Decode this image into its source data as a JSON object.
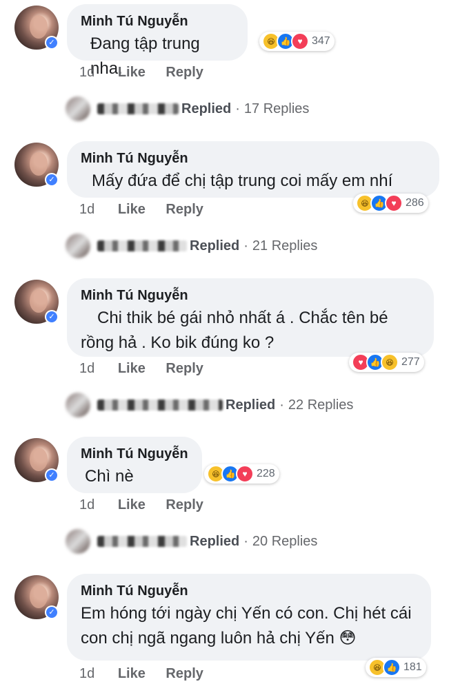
{
  "comments": [
    {
      "author": "Minh Tú Nguyễn",
      "text": "Đang tập trung nha.",
      "reactions_count": "347",
      "time": "1d",
      "like": "Like",
      "reply": "Reply",
      "replied": "Replied",
      "replies": "17 Replies"
    },
    {
      "author": "Minh Tú Nguyễn",
      "text": "Mấy đứa để chị tập trung coi mấy em nhí",
      "reactions_count": "286",
      "time": "1d",
      "like": "Like",
      "reply": "Reply",
      "replied": "Replied",
      "replies": "21 Replies"
    },
    {
      "author": "Minh Tú Nguyễn",
      "text": "Chi thik bé gái nhỏ nhất á . Chắc tên bé rồng hả . Ko bik đúng ko ?",
      "reactions_count": "277",
      "time": "1d",
      "like": "Like",
      "reply": "Reply",
      "replied": "Replied",
      "replies": "22 Replies"
    },
    {
      "author": "Minh Tú Nguyễn",
      "text": "Chì nè",
      "reactions_count": "228",
      "time": "1d",
      "like": "Like",
      "reply": "Reply",
      "replied": "Replied",
      "replies": "20 Replies"
    },
    {
      "author": "Minh Tú Nguyễn",
      "text": "Em hóng tới ngày chị Yến có con. Chị hét cái con chị ngã ngang luôn hả chị Yến 😳",
      "reactions_count": "181",
      "time": "1d",
      "like": "Like",
      "reply": "Reply"
    }
  ],
  "reaction_icons": {
    "haha": "haha-icon",
    "like": "like-icon",
    "love": "love-icon"
  },
  "colors": {
    "bubble": "#f0f2f5",
    "like": "#1877f2",
    "love": "#f33e58",
    "haha": "#f7c12b",
    "meta": "#65676b"
  }
}
